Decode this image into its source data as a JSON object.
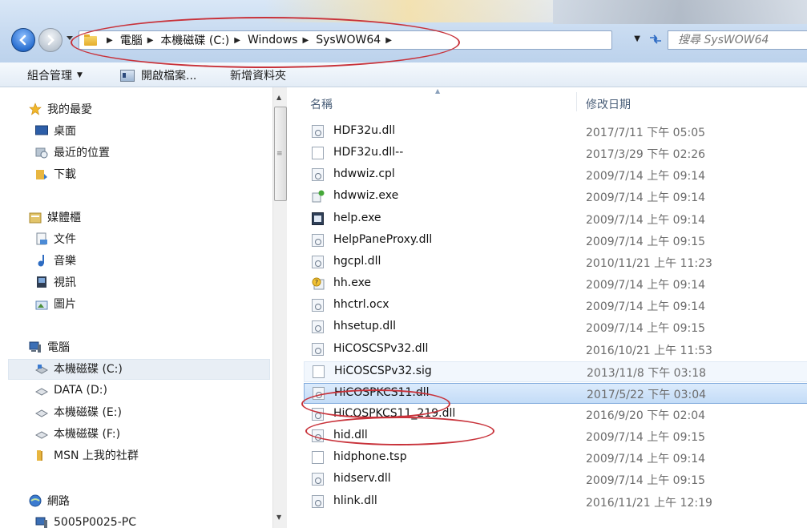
{
  "address_bar": {
    "crumbs": [
      "電腦",
      "本機磁碟 (C:)",
      "Windows",
      "SysWOW64"
    ],
    "search_placeholder": "搜尋 SysWOW64"
  },
  "toolbar": {
    "organize_label": "組合管理",
    "open_label": "開啟檔案...",
    "new_folder_label": "新增資料夾"
  },
  "nav_pane": {
    "favorites": {
      "label": "我的最愛",
      "items": [
        "桌面",
        "最近的位置",
        "下載"
      ]
    },
    "libraries": {
      "label": "媒體櫃",
      "items": [
        "文件",
        "音樂",
        "視訊",
        "圖片"
      ]
    },
    "computer": {
      "label": "電腦",
      "items": [
        "本機磁碟 (C:)",
        "DATA (D:)",
        "本機磁碟 (E:)",
        "本機磁碟 (F:)",
        "MSN 上我的社群"
      ],
      "selected": "本機磁碟 (C:)"
    },
    "network": {
      "label": "網路",
      "items": [
        "5005P0025-PC"
      ]
    }
  },
  "file_list": {
    "columns": {
      "name": "名稱",
      "date_modified": "修改日期"
    },
    "rows": [
      {
        "name": "HDF32u.dll",
        "date": "2017/7/11 下午 05:05",
        "icon": "dll-icon"
      },
      {
        "name": "HDF32u.dll--",
        "date": "2017/3/29 下午 02:26",
        "icon": "blank-file-icon"
      },
      {
        "name": "hdwwiz.cpl",
        "date": "2009/7/14 上午 09:14",
        "icon": "dll-icon"
      },
      {
        "name": "hdwwiz.exe",
        "date": "2009/7/14 上午 09:14",
        "icon": "hardware-wizard-icon"
      },
      {
        "name": "help.exe",
        "date": "2009/7/14 上午 09:14",
        "icon": "exe-window-icon"
      },
      {
        "name": "HelpPaneProxy.dll",
        "date": "2009/7/14 上午 09:15",
        "icon": "dll-icon"
      },
      {
        "name": "hgcpl.dll",
        "date": "2010/11/21 上午 11:23",
        "icon": "dll-icon"
      },
      {
        "name": "hh.exe",
        "date": "2009/7/14 上午 09:14",
        "icon": "help-question-icon"
      },
      {
        "name": "hhctrl.ocx",
        "date": "2009/7/14 上午 09:14",
        "icon": "dll-icon"
      },
      {
        "name": "hhsetup.dll",
        "date": "2009/7/14 上午 09:15",
        "icon": "dll-icon"
      },
      {
        "name": "HiCOSCSPv32.dll",
        "date": "2016/10/21 上午 11:53",
        "icon": "dll-icon"
      },
      {
        "name": "HiCOSCSPv32.sig",
        "date": "2013/11/8 下午 03:18",
        "icon": "blank-file-icon"
      },
      {
        "name": "HiCOSPKCS11.dll",
        "date": "2017/5/22 下午 03:04",
        "icon": "dll-icon"
      },
      {
        "name": "HiCOSPKCS11_219.dll",
        "date": "2016/9/20 下午 02:04",
        "icon": "dll-icon"
      },
      {
        "name": "hid.dll",
        "date": "2009/7/14 上午 09:15",
        "icon": "dll-icon"
      },
      {
        "name": "hidphone.tsp",
        "date": "2009/7/14 上午 09:14",
        "icon": "blank-file-icon"
      },
      {
        "name": "hidserv.dll",
        "date": "2009/7/14 上午 09:15",
        "icon": "dll-icon"
      },
      {
        "name": "hlink.dll",
        "date": "2016/11/21 上午 12:19",
        "icon": "dll-icon"
      }
    ]
  },
  "colors": {
    "annotation_red": "#c8323a",
    "selection_blue": "#c3dcf7",
    "accent_blue": "#2a6fd0"
  }
}
